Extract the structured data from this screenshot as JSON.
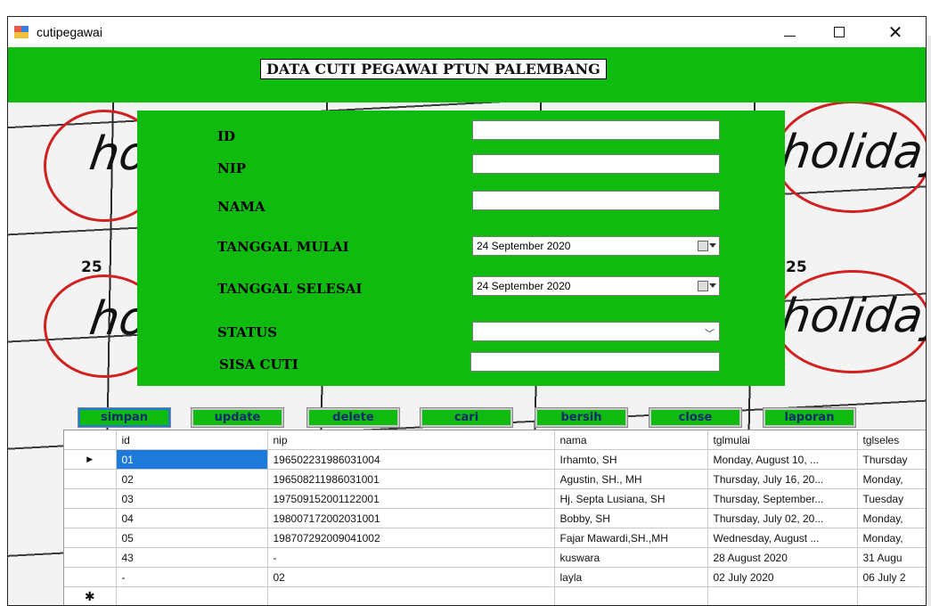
{
  "window": {
    "title": "cutipegawai",
    "minimize_glyph": "",
    "close_glyph": "✕"
  },
  "header": {
    "title": "DATA CUTI PEGAWAI PTUN PALEMBANG"
  },
  "background": {
    "word_left_top": "ho",
    "word_right_top": "holiday",
    "word_left_mid": "ho",
    "word_right_mid": "holiday",
    "num_left": "25",
    "num_right": "25"
  },
  "form": {
    "id_label": "ID",
    "nip_label": "NIP",
    "nama_label": "NAMA",
    "tanggal_mulai_label": "TANGGAL MULAI",
    "tanggal_selesai_label": "TANGGAL SELESAI",
    "status_label": "STATUS",
    "sisa_cuti_label": "SISA CUTI",
    "id_value": "",
    "nip_value": "",
    "nama_value": "",
    "tanggal_mulai_value": "24 September 2020",
    "tanggal_selesai_value": "24 September 2020",
    "status_value": "",
    "sisa_cuti_value": ""
  },
  "buttons": {
    "simpan": "simpan",
    "update": "update",
    "delete": "delete",
    "cari": "cari",
    "bersih": "bersih",
    "close": "close",
    "laporan": "laporan"
  },
  "grid": {
    "columns": [
      "id",
      "nip",
      "nama",
      "tglmulai",
      "tglseles"
    ],
    "rows": [
      [
        "01",
        "196502231986031004",
        "Irhamto, SH",
        "Monday, August 10, ...",
        "Thursday"
      ],
      [
        "02",
        "196508211986031001",
        "Agustin, SH., MH",
        "Thursday, July 16, 20...",
        "Monday,"
      ],
      [
        "03",
        "197509152001122001",
        "Hj. Septa Lusiana, SH",
        "Thursday, September...",
        "Tuesday"
      ],
      [
        "04",
        "198007172002031001",
        "Bobby, SH",
        "Thursday, July 02, 20...",
        "Monday,"
      ],
      [
        "05",
        "198707292009041002",
        "Fajar Mawardi,SH.,MH",
        "Wednesday, August ...",
        "Monday,"
      ],
      [
        "43",
        "-",
        "kuswara",
        "28 August 2020",
        "31 Augu"
      ],
      [
        "-",
        "02",
        "layla",
        "02 July 2020",
        "06 July 2"
      ]
    ],
    "current_row_marker": "▶",
    "new_row_marker": "✱"
  },
  "colors": {
    "accent_green": "#0fbb0f",
    "selection_blue": "#1e7ad8",
    "button_text": "#0c2a6e"
  }
}
